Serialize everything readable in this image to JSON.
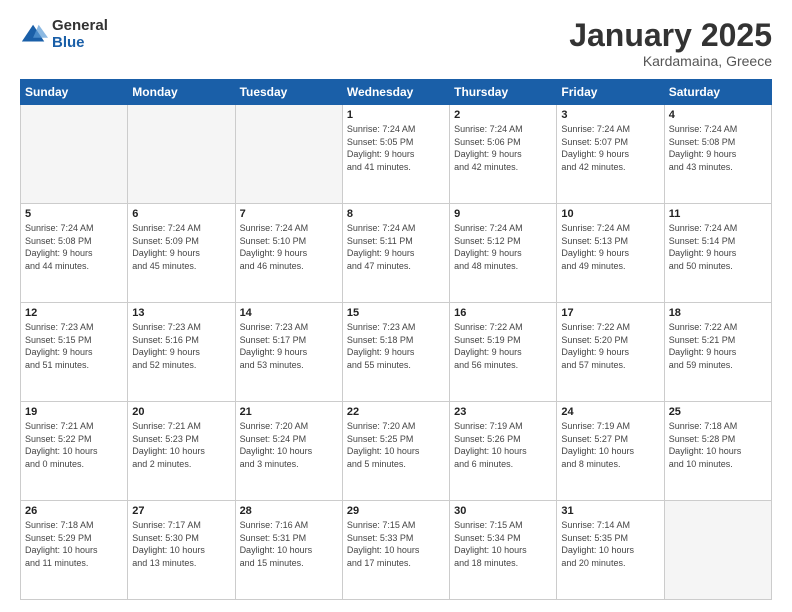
{
  "logo": {
    "general": "General",
    "blue": "Blue"
  },
  "header": {
    "month": "January 2025",
    "location": "Kardamaina, Greece"
  },
  "days_of_week": [
    "Sunday",
    "Monday",
    "Tuesday",
    "Wednesday",
    "Thursday",
    "Friday",
    "Saturday"
  ],
  "weeks": [
    [
      {
        "day": "",
        "info": ""
      },
      {
        "day": "",
        "info": ""
      },
      {
        "day": "",
        "info": ""
      },
      {
        "day": "1",
        "info": "Sunrise: 7:24 AM\nSunset: 5:05 PM\nDaylight: 9 hours\nand 41 minutes."
      },
      {
        "day": "2",
        "info": "Sunrise: 7:24 AM\nSunset: 5:06 PM\nDaylight: 9 hours\nand 42 minutes."
      },
      {
        "day": "3",
        "info": "Sunrise: 7:24 AM\nSunset: 5:07 PM\nDaylight: 9 hours\nand 42 minutes."
      },
      {
        "day": "4",
        "info": "Sunrise: 7:24 AM\nSunset: 5:08 PM\nDaylight: 9 hours\nand 43 minutes."
      }
    ],
    [
      {
        "day": "5",
        "info": "Sunrise: 7:24 AM\nSunset: 5:08 PM\nDaylight: 9 hours\nand 44 minutes."
      },
      {
        "day": "6",
        "info": "Sunrise: 7:24 AM\nSunset: 5:09 PM\nDaylight: 9 hours\nand 45 minutes."
      },
      {
        "day": "7",
        "info": "Sunrise: 7:24 AM\nSunset: 5:10 PM\nDaylight: 9 hours\nand 46 minutes."
      },
      {
        "day": "8",
        "info": "Sunrise: 7:24 AM\nSunset: 5:11 PM\nDaylight: 9 hours\nand 47 minutes."
      },
      {
        "day": "9",
        "info": "Sunrise: 7:24 AM\nSunset: 5:12 PM\nDaylight: 9 hours\nand 48 minutes."
      },
      {
        "day": "10",
        "info": "Sunrise: 7:24 AM\nSunset: 5:13 PM\nDaylight: 9 hours\nand 49 minutes."
      },
      {
        "day": "11",
        "info": "Sunrise: 7:24 AM\nSunset: 5:14 PM\nDaylight: 9 hours\nand 50 minutes."
      }
    ],
    [
      {
        "day": "12",
        "info": "Sunrise: 7:23 AM\nSunset: 5:15 PM\nDaylight: 9 hours\nand 51 minutes."
      },
      {
        "day": "13",
        "info": "Sunrise: 7:23 AM\nSunset: 5:16 PM\nDaylight: 9 hours\nand 52 minutes."
      },
      {
        "day": "14",
        "info": "Sunrise: 7:23 AM\nSunset: 5:17 PM\nDaylight: 9 hours\nand 53 minutes."
      },
      {
        "day": "15",
        "info": "Sunrise: 7:23 AM\nSunset: 5:18 PM\nDaylight: 9 hours\nand 55 minutes."
      },
      {
        "day": "16",
        "info": "Sunrise: 7:22 AM\nSunset: 5:19 PM\nDaylight: 9 hours\nand 56 minutes."
      },
      {
        "day": "17",
        "info": "Sunrise: 7:22 AM\nSunset: 5:20 PM\nDaylight: 9 hours\nand 57 minutes."
      },
      {
        "day": "18",
        "info": "Sunrise: 7:22 AM\nSunset: 5:21 PM\nDaylight: 9 hours\nand 59 minutes."
      }
    ],
    [
      {
        "day": "19",
        "info": "Sunrise: 7:21 AM\nSunset: 5:22 PM\nDaylight: 10 hours\nand 0 minutes."
      },
      {
        "day": "20",
        "info": "Sunrise: 7:21 AM\nSunset: 5:23 PM\nDaylight: 10 hours\nand 2 minutes."
      },
      {
        "day": "21",
        "info": "Sunrise: 7:20 AM\nSunset: 5:24 PM\nDaylight: 10 hours\nand 3 minutes."
      },
      {
        "day": "22",
        "info": "Sunrise: 7:20 AM\nSunset: 5:25 PM\nDaylight: 10 hours\nand 5 minutes."
      },
      {
        "day": "23",
        "info": "Sunrise: 7:19 AM\nSunset: 5:26 PM\nDaylight: 10 hours\nand 6 minutes."
      },
      {
        "day": "24",
        "info": "Sunrise: 7:19 AM\nSunset: 5:27 PM\nDaylight: 10 hours\nand 8 minutes."
      },
      {
        "day": "25",
        "info": "Sunrise: 7:18 AM\nSunset: 5:28 PM\nDaylight: 10 hours\nand 10 minutes."
      }
    ],
    [
      {
        "day": "26",
        "info": "Sunrise: 7:18 AM\nSunset: 5:29 PM\nDaylight: 10 hours\nand 11 minutes."
      },
      {
        "day": "27",
        "info": "Sunrise: 7:17 AM\nSunset: 5:30 PM\nDaylight: 10 hours\nand 13 minutes."
      },
      {
        "day": "28",
        "info": "Sunrise: 7:16 AM\nSunset: 5:31 PM\nDaylight: 10 hours\nand 15 minutes."
      },
      {
        "day": "29",
        "info": "Sunrise: 7:15 AM\nSunset: 5:33 PM\nDaylight: 10 hours\nand 17 minutes."
      },
      {
        "day": "30",
        "info": "Sunrise: 7:15 AM\nSunset: 5:34 PM\nDaylight: 10 hours\nand 18 minutes."
      },
      {
        "day": "31",
        "info": "Sunrise: 7:14 AM\nSunset: 5:35 PM\nDaylight: 10 hours\nand 20 minutes."
      },
      {
        "day": "",
        "info": ""
      }
    ]
  ]
}
